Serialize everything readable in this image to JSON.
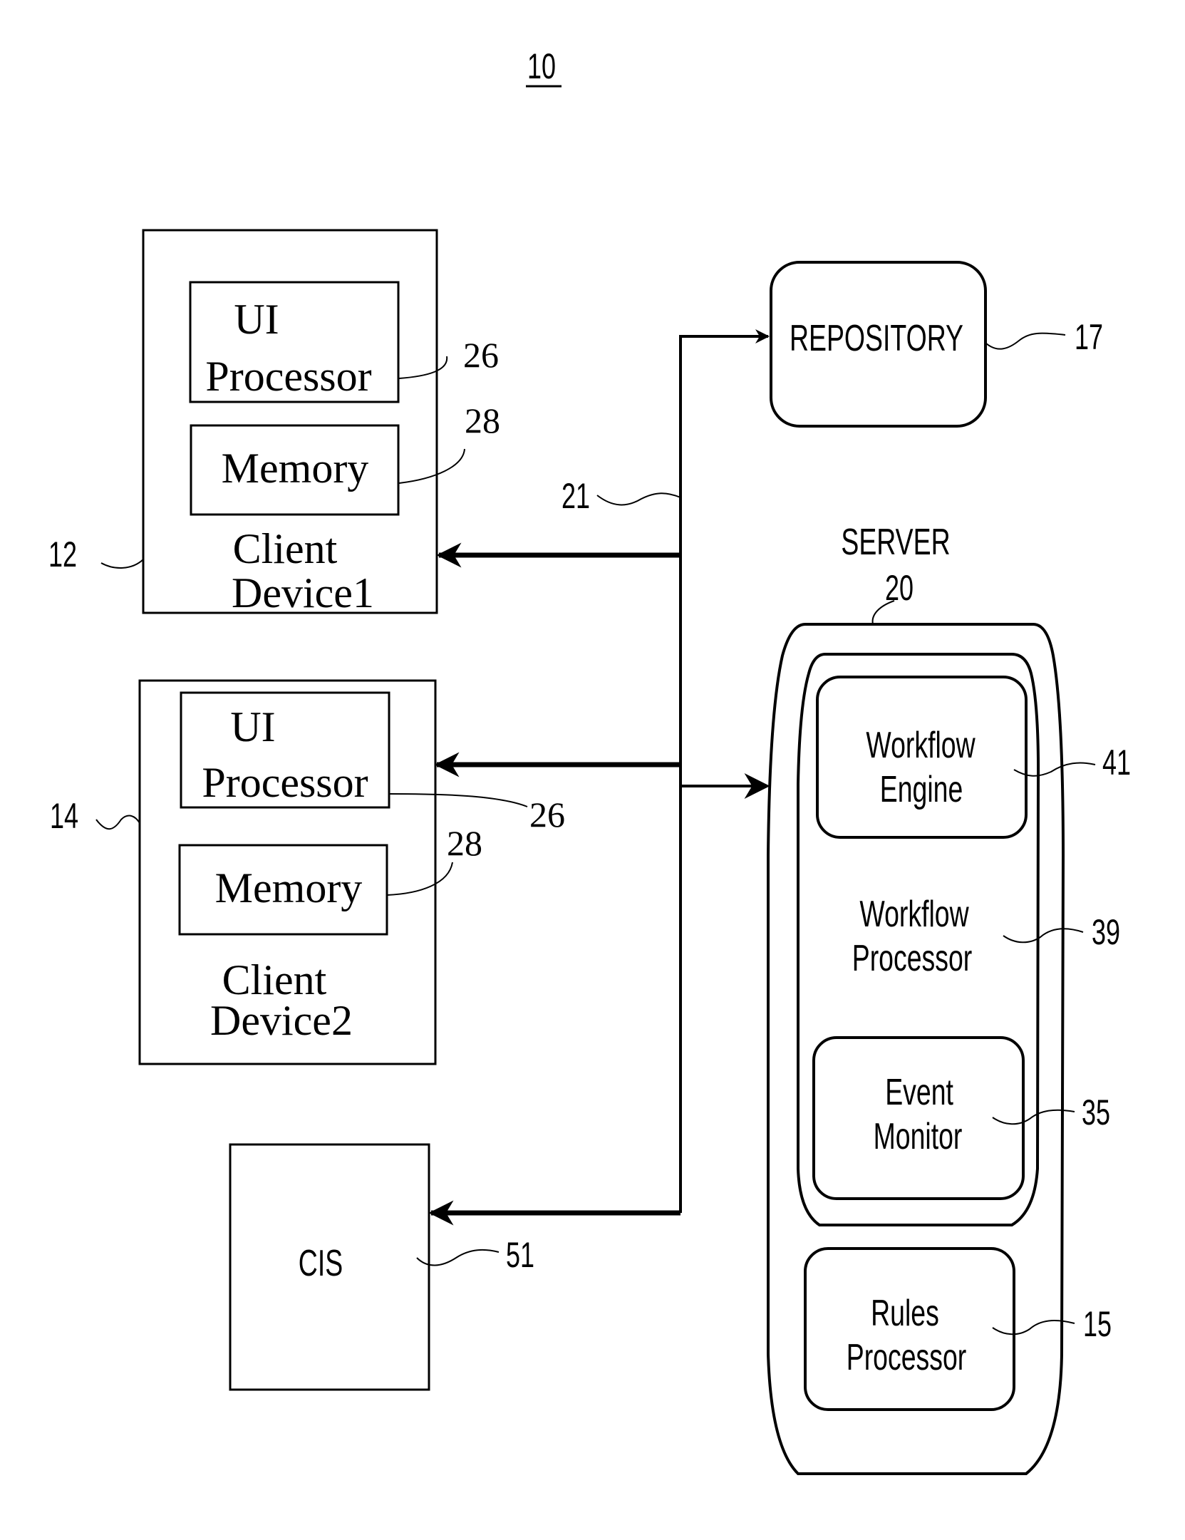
{
  "figure": {
    "number": "10",
    "accent_color": "#000000",
    "background_color": "#ffffff"
  },
  "client1": {
    "ref": "12",
    "title_line1": "Client",
    "title_line2": "Device1",
    "ui_processor": {
      "line1": "UI",
      "line2": "Processor",
      "ref": "26"
    },
    "memory": {
      "label": "Memory",
      "ref": "28"
    }
  },
  "client2": {
    "ref": "14",
    "title_line1": "Client",
    "title_line2": "Device2",
    "ui_processor": {
      "line1": "UI",
      "line2": "Processor",
      "ref": "26"
    },
    "memory": {
      "label": "Memory",
      "ref": "28"
    }
  },
  "cis": {
    "label": "CIS",
    "ref": "51"
  },
  "bus": {
    "ref": "21"
  },
  "repository": {
    "label": "REPOSITORY",
    "ref": "17"
  },
  "server": {
    "title": "SERVER",
    "ref": "20",
    "workflow_processor": {
      "line1": "Workflow",
      "line2": "Processor",
      "ref": "39"
    },
    "workflow_engine": {
      "line1": "Workflow",
      "line2": "Engine",
      "ref": "41"
    },
    "event_monitor": {
      "line1": "Event",
      "line2": "Monitor",
      "ref": "35"
    },
    "rules_processor": {
      "line1": "Rules",
      "line2": "Processor",
      "ref": "15"
    }
  }
}
